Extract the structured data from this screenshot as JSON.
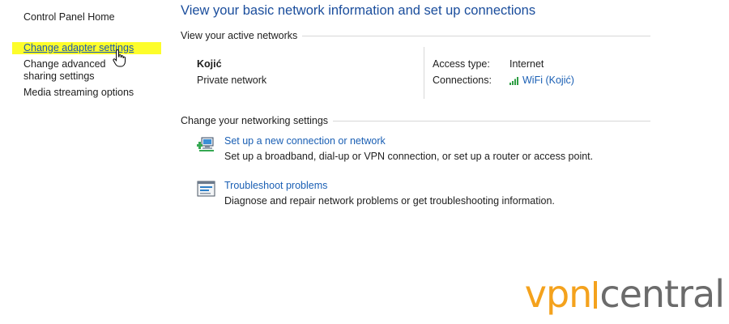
{
  "sidebar": {
    "home": "Control Panel Home",
    "items": [
      {
        "label": "Change adapter settings"
      },
      {
        "label": "Change advanced sharing settings"
      },
      {
        "label": "Media streaming options"
      }
    ]
  },
  "main": {
    "title": "View your basic network information and set up connections",
    "active_networks_header": "View your active networks",
    "network": {
      "name": "Kojić",
      "type": "Private network",
      "access_type_label": "Access type:",
      "access_type_value": "Internet",
      "connections_label": "Connections:",
      "connections_value": "WiFi (Kojić)"
    },
    "settings_header": "Change your networking settings",
    "tasks": [
      {
        "title": "Set up a new connection or network",
        "desc": "Set up a broadband, dial-up or VPN connection, or set up a router or access point.",
        "icon": "network-setup-icon"
      },
      {
        "title": "Troubleshoot problems",
        "desc": "Diagnose and repair network problems or get troubleshooting information.",
        "icon": "troubleshoot-icon"
      }
    ]
  },
  "watermark": {
    "part1": "vpn",
    "part2": "central"
  },
  "colors": {
    "link": "#1a5fb4",
    "title": "#1a4d9c",
    "highlight": "#fdfd2a",
    "brand_orange": "#f4a21d"
  }
}
